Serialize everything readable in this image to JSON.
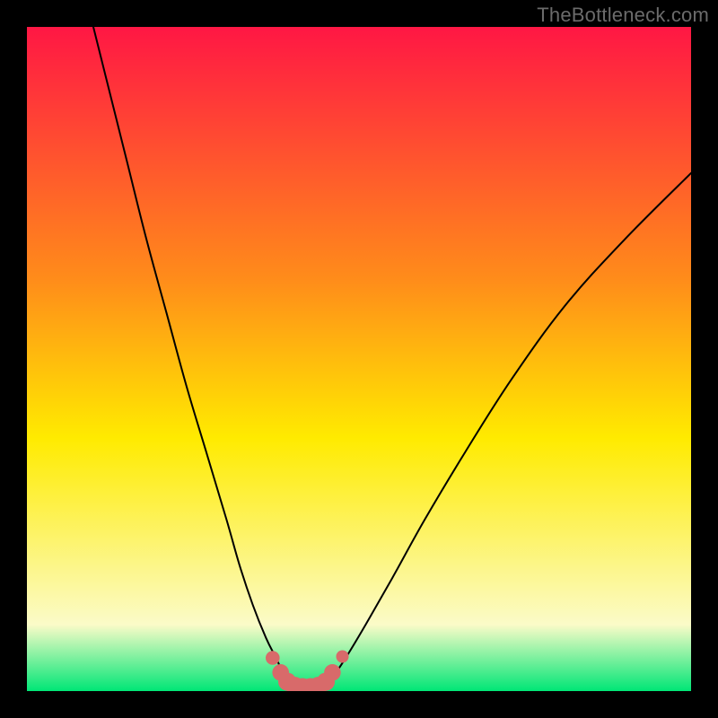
{
  "watermark": "TheBottleneck.com",
  "colors": {
    "bg_black": "#000000",
    "curve": "#000000",
    "marker_fill": "#d86a6a",
    "watermark_text": "#6b6b6b",
    "gradient_top": "#ff1744",
    "gradient_orange": "#ff8c1a",
    "gradient_yellow": "#ffeb00",
    "gradient_pale": "#fbfbc8",
    "gradient_green": "#00e676"
  },
  "chart_data": {
    "type": "line",
    "title": "",
    "xlabel": "",
    "ylabel": "",
    "xlim": [
      0,
      100
    ],
    "ylim": [
      0,
      100
    ],
    "series": [
      {
        "name": "left-branch",
        "x": [
          10,
          12,
          15,
          18,
          21,
          24,
          27,
          30,
          32,
          34,
          36,
          37.5,
          39
        ],
        "y": [
          100,
          92,
          80,
          68,
          57,
          46,
          36,
          26,
          19,
          13,
          8,
          5,
          2
        ]
      },
      {
        "name": "right-branch",
        "x": [
          46,
          48,
          51,
          55,
          60,
          66,
          73,
          81,
          90,
          100
        ],
        "y": [
          2,
          5,
          10,
          17,
          26,
          36,
          47,
          58,
          68,
          78
        ]
      },
      {
        "name": "valley-floor",
        "x": [
          39,
          40.5,
          42,
          43.5,
          45,
          46
        ],
        "y": [
          2,
          0.8,
          0.5,
          0.5,
          0.8,
          2
        ]
      }
    ],
    "markers": {
      "name": "valley-markers",
      "points": [
        {
          "x": 37.0,
          "y": 5.0,
          "r": 1.0
        },
        {
          "x": 38.2,
          "y": 2.8,
          "r": 1.2
        },
        {
          "x": 39.2,
          "y": 1.4,
          "r": 1.3
        },
        {
          "x": 40.3,
          "y": 0.8,
          "r": 1.3
        },
        {
          "x": 41.5,
          "y": 0.6,
          "r": 1.3
        },
        {
          "x": 42.7,
          "y": 0.6,
          "r": 1.3
        },
        {
          "x": 43.9,
          "y": 0.8,
          "r": 1.3
        },
        {
          "x": 45.0,
          "y": 1.4,
          "r": 1.3
        },
        {
          "x": 46.0,
          "y": 2.8,
          "r": 1.2
        },
        {
          "x": 47.5,
          "y": 5.2,
          "r": 0.9
        }
      ]
    },
    "gradient_stops": [
      {
        "offset": 0.0,
        "key": "gradient_top"
      },
      {
        "offset": 0.38,
        "key": "gradient_orange"
      },
      {
        "offset": 0.62,
        "key": "gradient_yellow"
      },
      {
        "offset": 0.9,
        "key": "gradient_pale"
      },
      {
        "offset": 1.0,
        "key": "gradient_green"
      }
    ]
  }
}
